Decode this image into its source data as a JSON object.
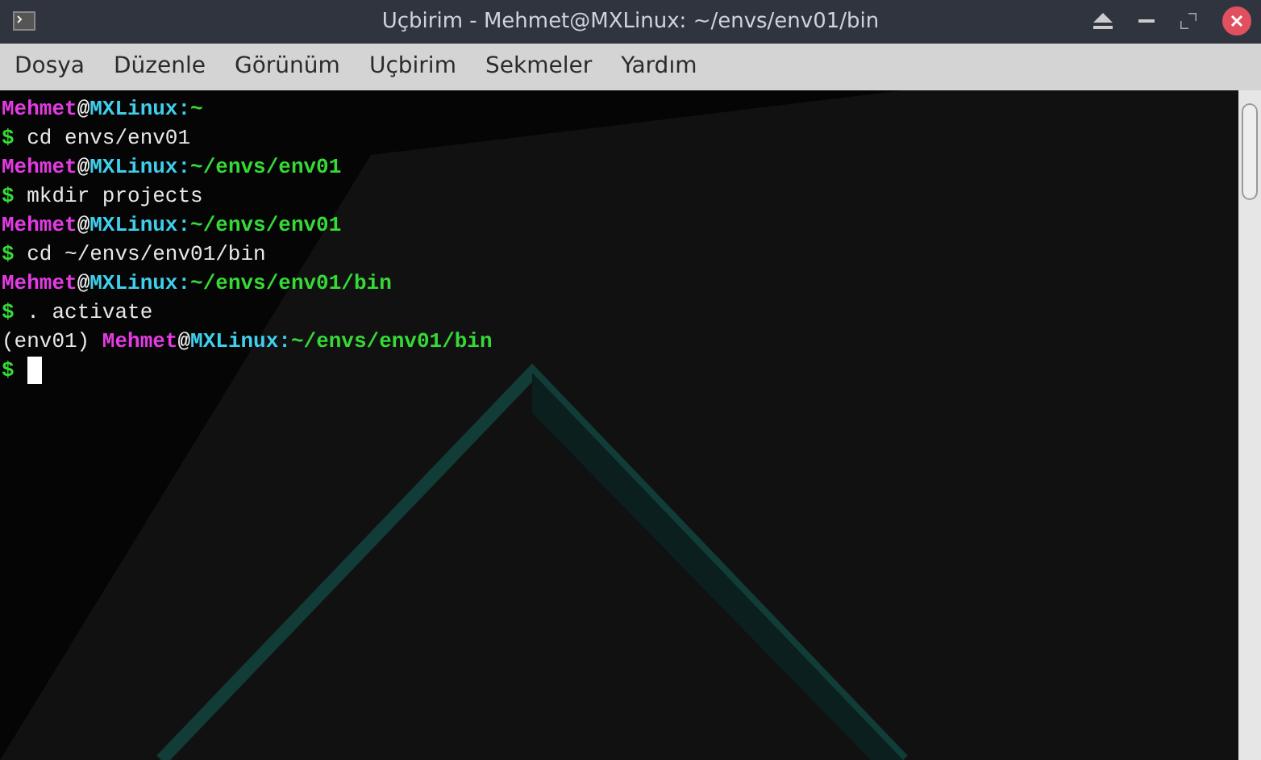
{
  "window": {
    "title": "Uçbirim - Mehmet@MXLinux: ~/envs/env01/bin"
  },
  "menu": [
    "Dosya",
    "Düzenle",
    "Görünüm",
    "Uçbirim",
    "Sekmeler",
    "Yardım"
  ],
  "terminal": {
    "lines": [
      {
        "segments": [
          {
            "text": "Mehmet",
            "kind": "user"
          },
          {
            "text": "@",
            "kind": "at"
          },
          {
            "text": "MXLinux",
            "kind": "host"
          },
          {
            "text": ":",
            "kind": "host"
          },
          {
            "text": "~",
            "kind": "path"
          }
        ]
      },
      {
        "segments": [
          {
            "text": "$",
            "kind": "prompt"
          },
          {
            "text": " cd envs/env01",
            "kind": "plain"
          }
        ]
      },
      {
        "segments": [
          {
            "text": "Mehmet",
            "kind": "user"
          },
          {
            "text": "@",
            "kind": "at"
          },
          {
            "text": "MXLinux",
            "kind": "host"
          },
          {
            "text": ":",
            "kind": "host"
          },
          {
            "text": "~/envs/env01",
            "kind": "path"
          }
        ]
      },
      {
        "segments": [
          {
            "text": "$",
            "kind": "prompt"
          },
          {
            "text": " mkdir projects",
            "kind": "plain"
          }
        ]
      },
      {
        "segments": [
          {
            "text": "Mehmet",
            "kind": "user"
          },
          {
            "text": "@",
            "kind": "at"
          },
          {
            "text": "MXLinux",
            "kind": "host"
          },
          {
            "text": ":",
            "kind": "host"
          },
          {
            "text": "~/envs/env01",
            "kind": "path"
          }
        ]
      },
      {
        "segments": [
          {
            "text": "$",
            "kind": "prompt"
          },
          {
            "text": " cd ~/envs/env01/bin",
            "kind": "plain"
          }
        ]
      },
      {
        "segments": [
          {
            "text": "Mehmet",
            "kind": "user"
          },
          {
            "text": "@",
            "kind": "at"
          },
          {
            "text": "MXLinux",
            "kind": "host"
          },
          {
            "text": ":",
            "kind": "host"
          },
          {
            "text": "~/envs/env01/bin",
            "kind": "path"
          }
        ]
      },
      {
        "segments": [
          {
            "text": "$",
            "kind": "prompt"
          },
          {
            "text": " . activate",
            "kind": "plain"
          }
        ]
      },
      {
        "segments": [
          {
            "text": "(env01) ",
            "kind": "plain"
          },
          {
            "text": "Mehmet",
            "kind": "user"
          },
          {
            "text": "@",
            "kind": "at"
          },
          {
            "text": "MXLinux",
            "kind": "host"
          },
          {
            "text": ":",
            "kind": "host"
          },
          {
            "text": "~/envs/env01/bin",
            "kind": "path"
          }
        ]
      },
      {
        "segments": [
          {
            "text": "$",
            "kind": "prompt"
          }
        ],
        "cursor": true
      }
    ]
  }
}
